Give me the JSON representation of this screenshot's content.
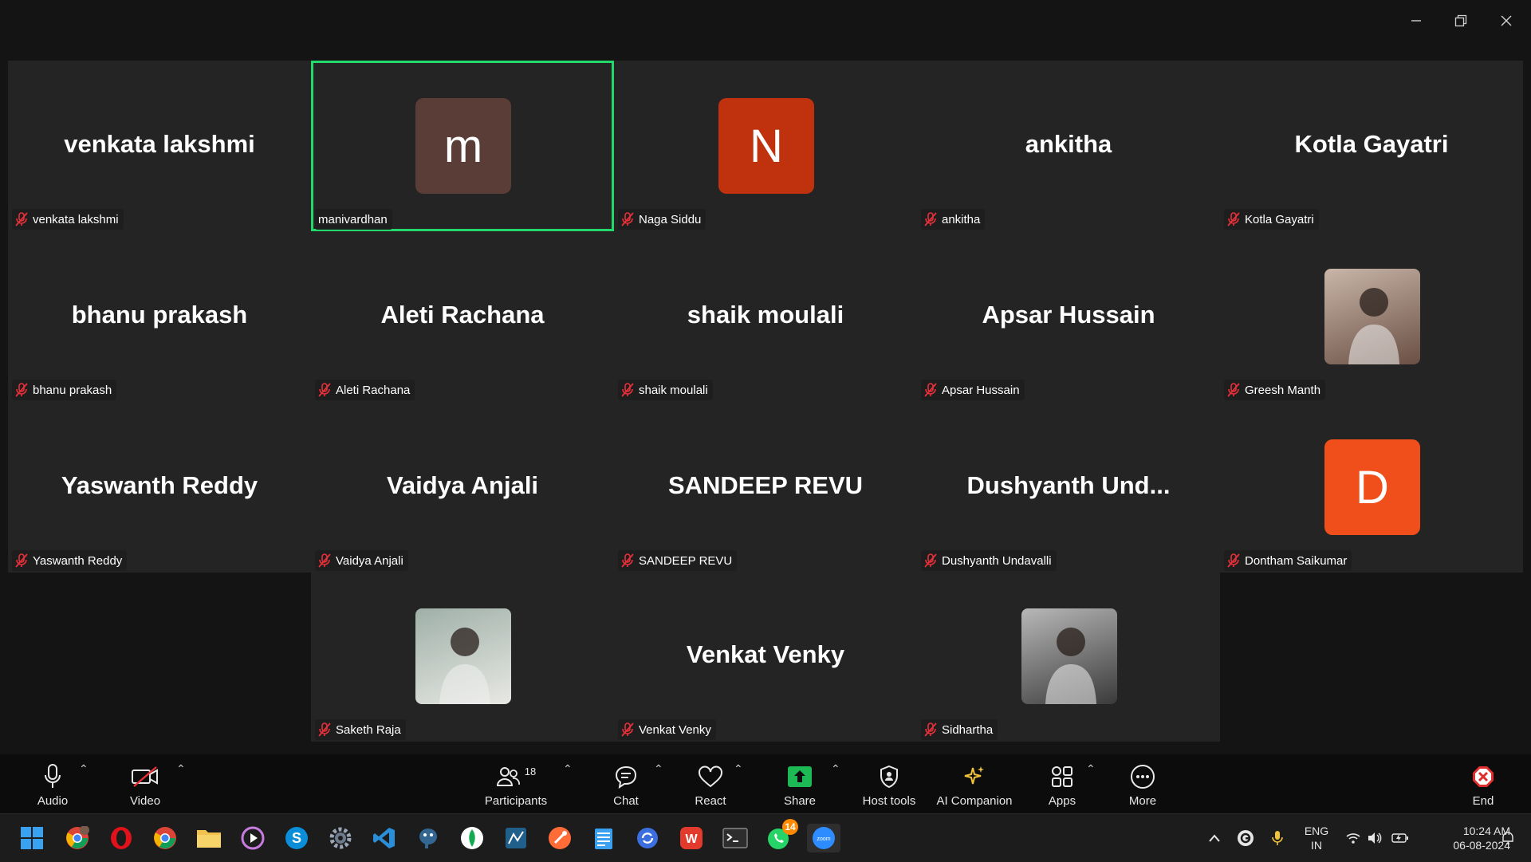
{
  "window": {
    "minimize_icon": "minimize-icon",
    "restore_icon": "restore-icon",
    "close_icon": "close-icon"
  },
  "gallery": {
    "tiles": [
      {
        "display": "venkata lakshmi",
        "label": "venkata lakshmi",
        "kind": "name"
      },
      {
        "display": "m",
        "label": "manivardhan",
        "kind": "avatar",
        "color": "#5a3d36",
        "active": true
      },
      {
        "display": "N",
        "label": "Naga Siddu",
        "kind": "avatar",
        "color": "#c0320e"
      },
      {
        "display": "ankitha",
        "label": "ankitha",
        "kind": "name"
      },
      {
        "display": "Kotla Gayatri",
        "label": "Kotla Gayatri",
        "kind": "name"
      },
      {
        "display": "bhanu prakash",
        "label": "bhanu prakash",
        "kind": "name"
      },
      {
        "display": "Aleti Rachana",
        "label": "Aleti Rachana",
        "kind": "name"
      },
      {
        "display": "shaik moulali",
        "label": "shaik moulali",
        "kind": "name"
      },
      {
        "display": "Apsar Hussain",
        "label": "Apsar Hussain",
        "kind": "name"
      },
      {
        "display": "",
        "label": "Greesh Manth",
        "kind": "photo"
      },
      {
        "display": "Yaswanth Reddy",
        "label": "Yaswanth Reddy",
        "kind": "name"
      },
      {
        "display": "Vaidya Anjali",
        "label": "Vaidya Anjali",
        "kind": "name"
      },
      {
        "display": "SANDEEP REVU",
        "label": "SANDEEP REVU",
        "kind": "name"
      },
      {
        "display": "Dushyanth  Und...",
        "label": "Dushyanth Undavalli",
        "kind": "name"
      },
      {
        "display": "D",
        "label": "Dontham Saikumar",
        "kind": "avatar",
        "color": "#f04e1a"
      },
      {
        "display": "",
        "label": "Saketh Raja",
        "kind": "photo"
      },
      {
        "display": "Venkat Venky",
        "label": "Venkat Venky",
        "kind": "name"
      },
      {
        "display": "",
        "label": "Sidhartha",
        "kind": "photo"
      }
    ]
  },
  "toolbar": {
    "audio": "Audio",
    "video": "Video",
    "participants": "Participants",
    "participants_count": "18",
    "chat": "Chat",
    "react": "React",
    "share": "Share",
    "host_tools": "Host tools",
    "ai_companion": "AI Companion",
    "apps": "Apps",
    "more": "More",
    "end": "End"
  },
  "taskbar": {
    "whatsapp_badge": "14",
    "language": "ENG",
    "region": "IN",
    "time": "10:24 AM",
    "date": "06-08-2024"
  },
  "colors": {
    "accent_active": "#23d96c",
    "share_green": "#1db954",
    "end_red": "#e02e2e"
  }
}
